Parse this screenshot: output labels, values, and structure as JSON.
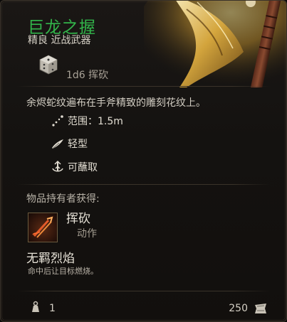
{
  "item": {
    "name": "巨龙之握",
    "subtitle": "精良 近战武器",
    "damage": "1d6 挥砍",
    "description": "余烬蛇纹遍布在手斧精致的雕刻花纹上。"
  },
  "properties": [
    {
      "icon": "range-icon",
      "label": "范围：1.5m"
    },
    {
      "icon": "feather-icon",
      "label": "轻型"
    },
    {
      "icon": "dip-icon",
      "label": "可蘸取"
    }
  ],
  "grants": {
    "header": "物品持有者获得:",
    "action_name": "挥砍",
    "action_type": "动作",
    "passive_name": "无羁烈焰",
    "passive_description": "命中后让目标燃烧。"
  },
  "footer": {
    "weight": "1",
    "price": "250"
  },
  "colors": {
    "name": "#32b44a",
    "background": "#141210",
    "border": "#3c342b"
  }
}
